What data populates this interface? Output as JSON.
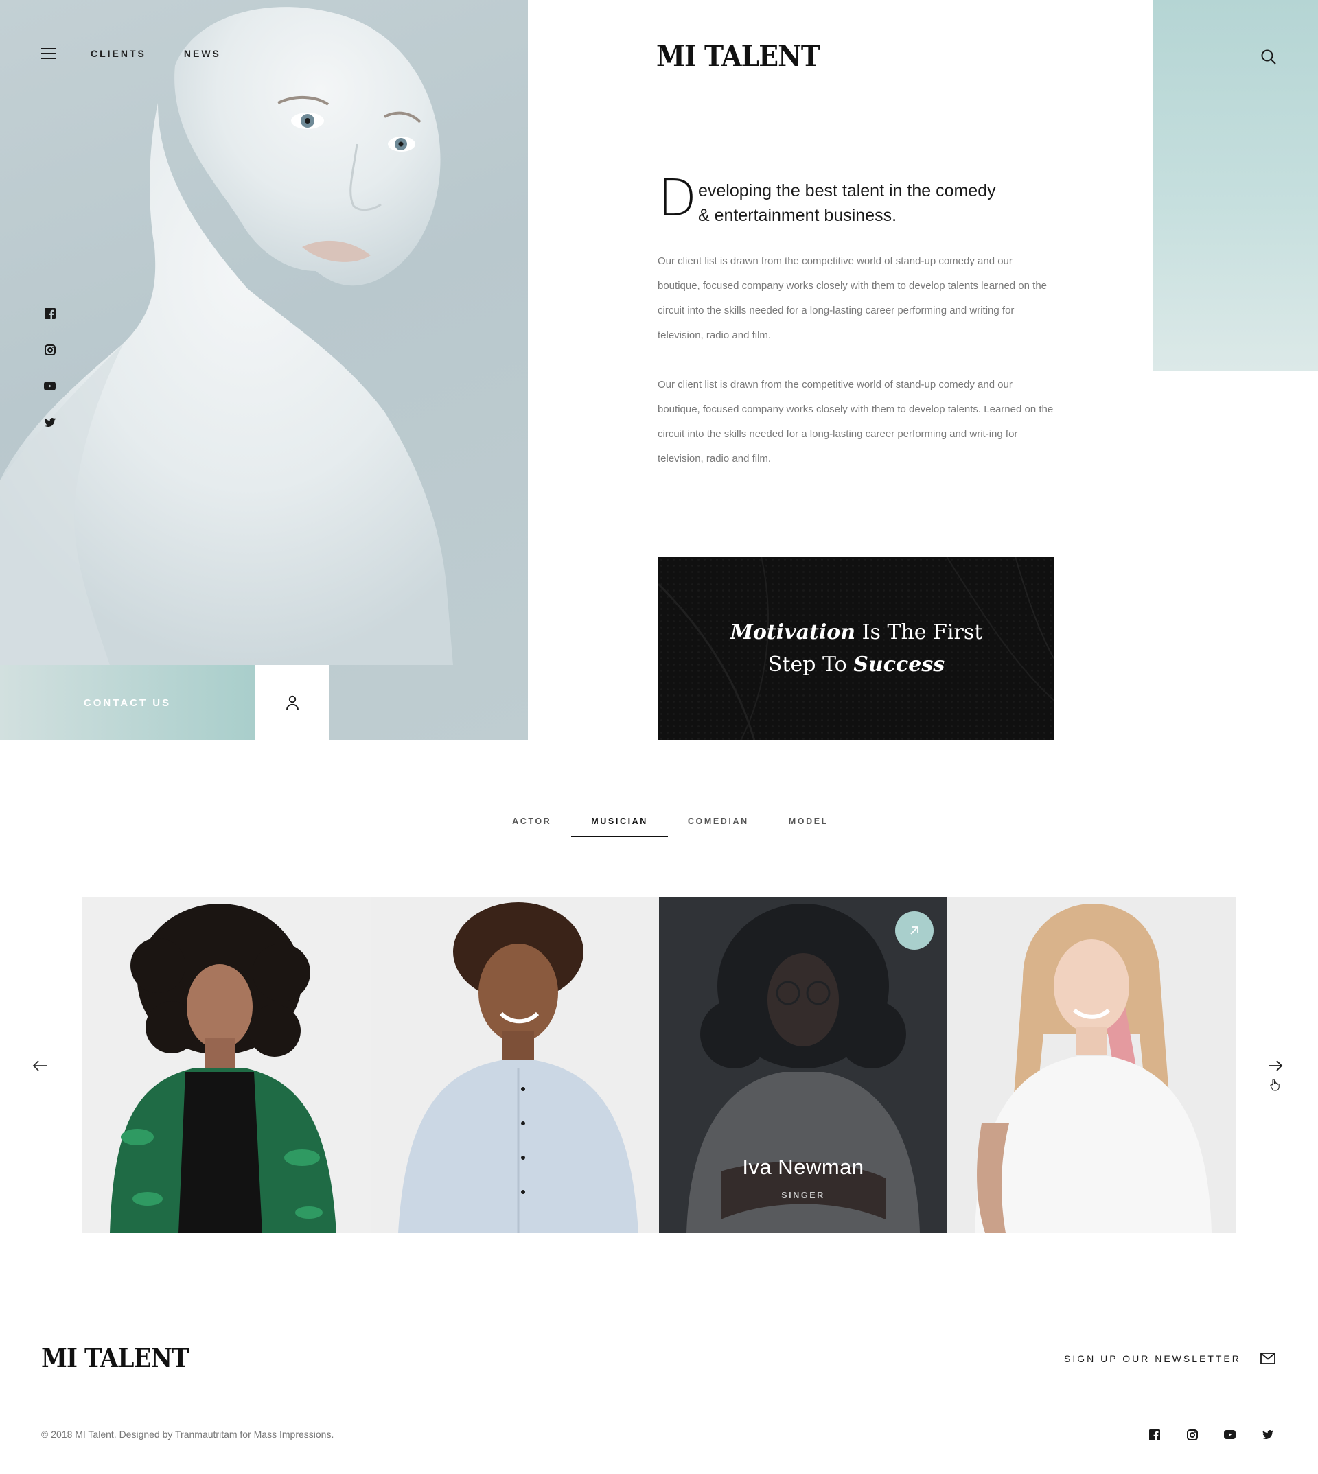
{
  "brand": {
    "logo": "MI TALENT"
  },
  "nav": {
    "items": [
      {
        "label": "CLIENTS"
      },
      {
        "label": "NEWS"
      }
    ]
  },
  "hero": {
    "contact_label": "CONTACT US",
    "social": [
      "facebook-icon",
      "instagram-icon",
      "youtube-icon",
      "twitter-icon"
    ]
  },
  "intro": {
    "dropcap": "D",
    "heading_line1": "eveloping the best talent in the comedy",
    "heading_line2": "& entertainment business.",
    "paragraph1": "Our client list is drawn from the competitive world of stand-up comedy and our boutique, focused company works closely with them to develop talents learned on the circuit into the skills needed for a long-lasting career performing and writing for television, radio and film.",
    "paragraph2": "Our client list is drawn from the competitive world of stand-up comedy and our boutique, focused company works closely with them to develop talents. Learned on the circuit into the skills needed for a long-lasting career performing and writ-ing for television, radio and film."
  },
  "quote": {
    "word1": "Motivation",
    "text1": " Is The First",
    "text2": "Step To ",
    "word2": "Success"
  },
  "tabs": [
    {
      "label": "ACTOR",
      "active": false
    },
    {
      "label": "MUSICIAN",
      "active": true
    },
    {
      "label": "COMEDIAN",
      "active": false
    },
    {
      "label": "MODEL",
      "active": false
    }
  ],
  "talents": {
    "featured": {
      "name": "Iva Newman",
      "role": "SINGER"
    }
  },
  "footer": {
    "logo": "MI TALENT",
    "newsletter_label": "SIGN UP OUR NEWSLETTER",
    "copyright": "© 2018 MI Talent. Designed by Tranmautritam for Mass Impressions.",
    "social": [
      "facebook-icon",
      "instagram-icon",
      "youtube-icon",
      "twitter-icon"
    ]
  },
  "colors": {
    "accent_teal": "#a9cfcc",
    "dark": "#121212",
    "text_muted": "#7a7a7a"
  }
}
